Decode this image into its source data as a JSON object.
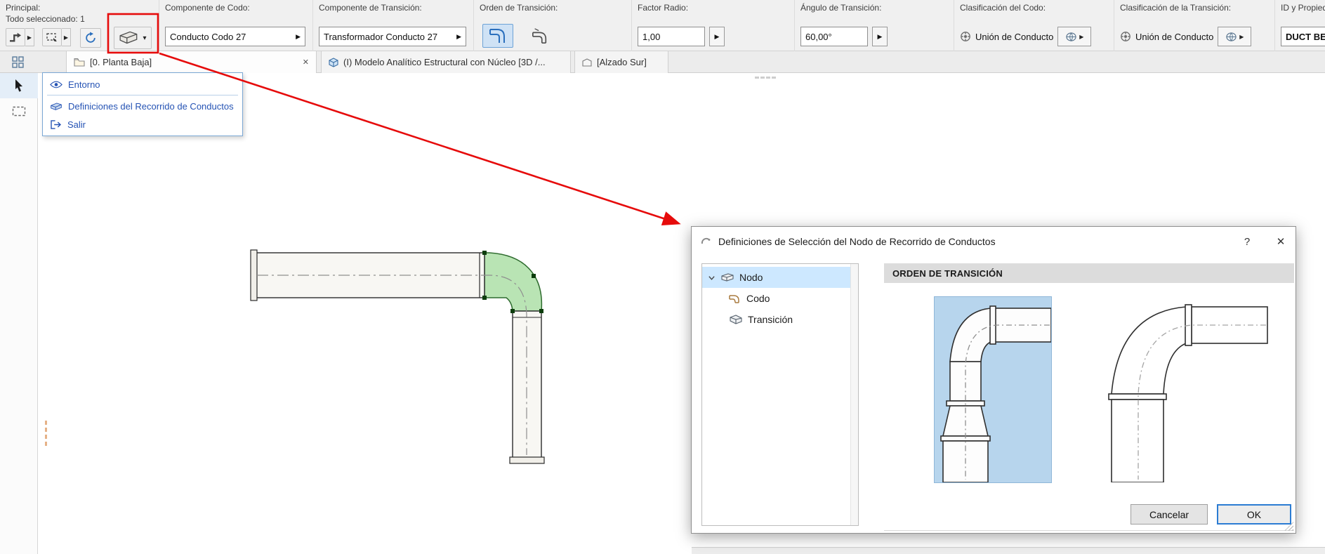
{
  "glyphs": {
    "flyout": "▶",
    "dropdown": "▾",
    "close_tab": "✕"
  },
  "colors": {
    "annotation_red": "#e60b0b",
    "selection_green_fill": "#b9e4b4",
    "selection_green_stroke": "#2e6b2e",
    "tree_selection_blue": "#cde8ff",
    "preview_selected_bg": "#b7d5ed",
    "accent_blue": "#2a6fbd",
    "menu_text_blue": "#2553b4"
  },
  "toolbar": {
    "principal": {
      "label": "Principal:",
      "status": "Todo seleccionado: 1"
    },
    "codo": {
      "label": "Componente de Codo:",
      "value": "Conducto Codo 27"
    },
    "transicion": {
      "label": "Componente de Transición:",
      "value": "Transformador Conducto 27"
    },
    "orden": {
      "label": "Orden de Transición:"
    },
    "factor_radio": {
      "label": "Factor Radio:",
      "value": "1,00"
    },
    "angulo": {
      "label": "Ángulo de Transición:",
      "value": "60,00°"
    },
    "clasif_codo": {
      "label": "Clasificación del Codo:",
      "value": "Unión de Conducto"
    },
    "clasif_transicion": {
      "label": "Clasificación de la Transición:",
      "value": "Unión de Conducto"
    },
    "id_propiedades": {
      "label": "ID y Propiedade",
      "value": "DUCT BEN"
    }
  },
  "tabs": {
    "tab1": "[0. Planta Baja]",
    "tab2": "(I) Modelo Analítico Estructural con Núcleo [3D /...",
    "tab3": "[Alzado Sur]"
  },
  "context_menu": {
    "items": [
      {
        "label": "Entorno",
        "icon": "eye-icon"
      },
      {
        "label": "Definiciones del Recorrido de Conductos",
        "icon": "duct-settings-icon"
      },
      {
        "label": "Salir",
        "icon": "exit-icon"
      }
    ]
  },
  "dialog": {
    "title": "Definiciones de Selección del Nodo de Recorrido de Conductos",
    "help": "?",
    "close": "✕",
    "tree": {
      "items": [
        {
          "label": "Nodo",
          "selected": true
        },
        {
          "label": "Codo",
          "selected": false
        },
        {
          "label": "Transición",
          "selected": false
        }
      ]
    },
    "panel": {
      "header": "ORDEN DE TRANSICIÓN"
    },
    "buttons": {
      "cancel": "Cancelar",
      "ok": "OK"
    }
  }
}
